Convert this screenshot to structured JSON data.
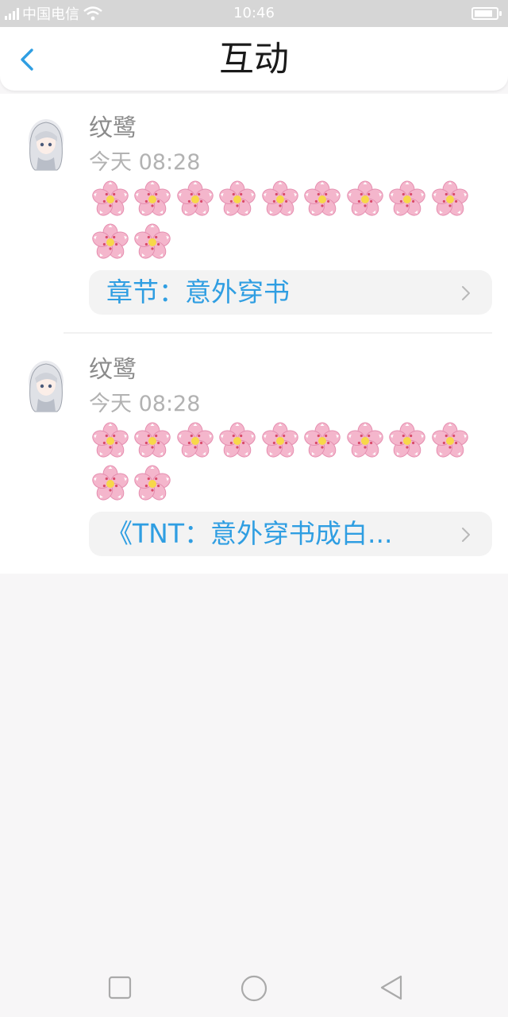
{
  "status_bar": {
    "carrier": "中国电信",
    "time": "10:46",
    "battery_level": 0.85
  },
  "header": {
    "title": "互动",
    "back_icon": "chevron-left-icon"
  },
  "colors": {
    "accent": "#2f9ee2",
    "title": "#1a1a1a",
    "meta": "#b2b2b2",
    "background": "#f7f6f7"
  },
  "items": [
    {
      "username": "纹鹭",
      "time": "今天 08:28",
      "blossom_count": 11,
      "chapter": "章节：意外穿书"
    },
    {
      "username": "纹鹭",
      "time": "今天 08:28",
      "blossom_count": 11,
      "chapter": "《TNT：意外穿书成白..."
    }
  ],
  "navbar": {
    "icons": [
      "square-icon",
      "circle-icon",
      "triangle-back-icon"
    ]
  }
}
